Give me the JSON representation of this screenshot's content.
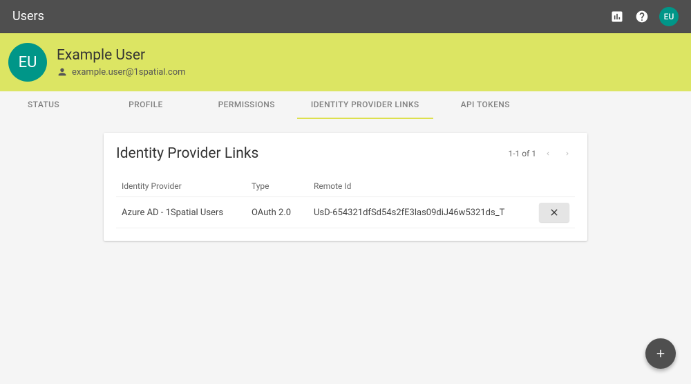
{
  "topbar": {
    "title": "Users",
    "avatar_initials": "EU"
  },
  "user": {
    "name": "Example User",
    "email": "example.user@1spatial.com",
    "avatar_initials": "EU"
  },
  "tabs": [
    {
      "label": "STATUS",
      "active": false
    },
    {
      "label": "PROFILE",
      "active": false
    },
    {
      "label": "PERMISSIONS",
      "active": false
    },
    {
      "label": "IDENTITY PROVIDER LINKS",
      "active": true
    },
    {
      "label": "API TOKENS",
      "active": false
    }
  ],
  "card": {
    "title": "Identity Provider Links",
    "pagination": "1-1 of 1"
  },
  "table": {
    "headers": {
      "provider": "Identity Provider",
      "type": "Type",
      "remote": "Remote Id"
    },
    "rows": [
      {
        "provider": "Azure AD - 1Spatial Users",
        "type": "OAuth 2.0",
        "remote": "UsD-654321dfSd54s2fE3las09diJ46w5321ds_T"
      }
    ]
  }
}
